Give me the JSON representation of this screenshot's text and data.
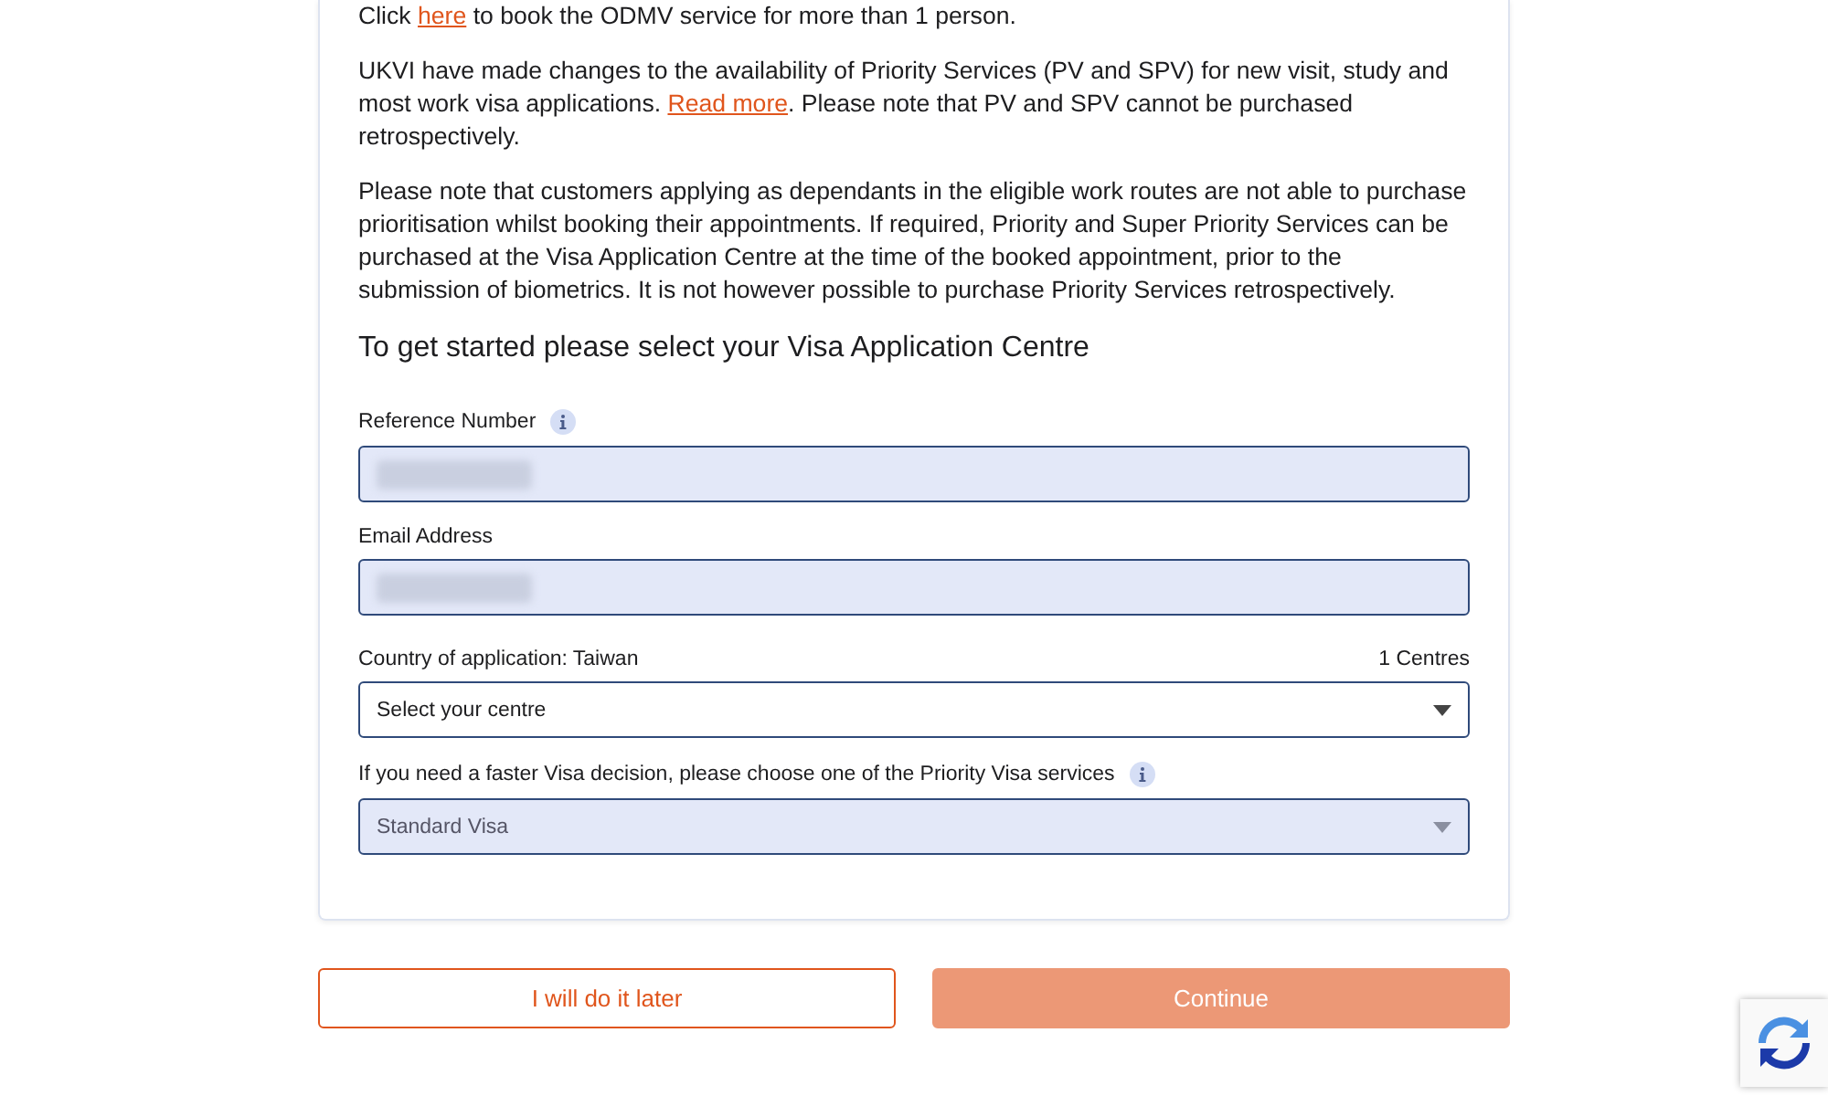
{
  "notices": [
    {
      "parts": [
        {
          "kind": "text",
          "text": "Click "
        },
        {
          "kind": "link",
          "text": "here"
        },
        {
          "kind": "text",
          "text": " to book the ODMV service for more than 1 person."
        }
      ]
    },
    {
      "parts": [
        {
          "kind": "text",
          "text": "UKVI have made changes to the availability of Priority Services (PV and SPV) for new visit, study and most work visa applications. "
        },
        {
          "kind": "link",
          "text": "Read more"
        },
        {
          "kind": "text",
          "text": ". Please note that PV and SPV cannot be purchased retrospectively."
        }
      ]
    },
    {
      "parts": [
        {
          "kind": "text",
          "text": "Please note that customers applying as dependants in the eligible work routes are not able to purchase prioritisation whilst booking their appointments. If required, Priority and Super Priority Services can be purchased at the Visa Application Centre at the time of the booked appointment, prior to the submission of biometrics. It is not however possible to purchase Priority Services retrospectively."
        }
      ]
    }
  ],
  "heading": "To get started please select your Visa Application Centre",
  "fields": [
    {
      "kind": "text",
      "label": "Reference Number",
      "info": true,
      "redacted": true
    },
    {
      "kind": "text",
      "label": "Email Address",
      "info": false,
      "redacted": true
    },
    {
      "kind": "select",
      "label": "Country of application: Taiwan",
      "count": "1 Centres",
      "value": "Select your centre",
      "info": false,
      "disabled": false
    },
    {
      "kind": "select",
      "label": "If you need a faster Visa decision, please choose one of the Priority Visa services",
      "value": "Standard Visa",
      "info": true,
      "disabled": true
    }
  ],
  "buttons": [
    {
      "kind": "secondary",
      "label": "I will do it later",
      "disabled": false
    },
    {
      "kind": "primary",
      "label": "Continue",
      "disabled": true
    }
  ]
}
